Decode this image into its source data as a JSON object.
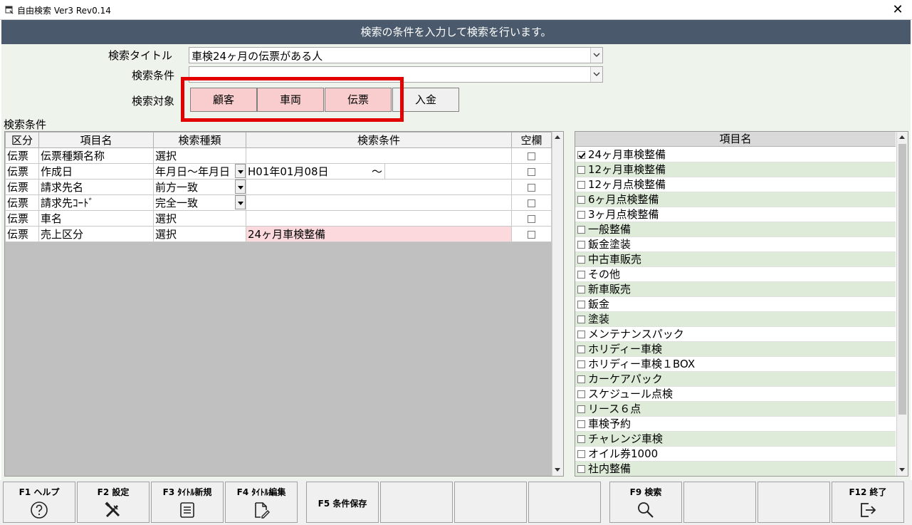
{
  "window": {
    "title": "自由検索 Ver3 Rev0.14",
    "close_symbol": "✕"
  },
  "banner": "検索の条件を入力して検索を行います。",
  "form": {
    "title_label": "検索タイトル",
    "title_value": "車検24ヶ月の伝票がある人",
    "condition_label": "検索条件",
    "condition_value": "",
    "target_label": "検索対象",
    "targets": [
      "顧客",
      "車両",
      "伝票",
      "入金"
    ],
    "selected_targets": [
      "顧客",
      "車両",
      "伝票"
    ]
  },
  "grid": {
    "section_label": "検索条件",
    "headers": [
      "区分",
      "項目名",
      "検索種類",
      "検索条件",
      "空欄"
    ],
    "rows": [
      {
        "kubun": "伝票",
        "item": "伝票種類名称",
        "type": "選択",
        "condition": "",
        "condition_to": "",
        "blank": false
      },
      {
        "kubun": "伝票",
        "item": "作成日",
        "type": "年月日～年月日",
        "condition": "H01年01月08日",
        "condition_to": "～",
        "blank": false
      },
      {
        "kubun": "伝票",
        "item": "請求先名",
        "type": "前方一致",
        "condition": "",
        "condition_to": "",
        "blank": false
      },
      {
        "kubun": "伝票",
        "item": "請求先ｺｰﾄﾞ",
        "type": "完全一致",
        "condition": "",
        "condition_to": "",
        "blank": false
      },
      {
        "kubun": "伝票",
        "item": "車名",
        "type": "選択",
        "condition": "",
        "condition_to": "",
        "blank": false
      },
      {
        "kubun": "伝票",
        "item": "売上区分",
        "type": "選択",
        "condition": "24ヶ月車検整備",
        "condition_to": "",
        "blank": false
      }
    ]
  },
  "list": {
    "header": "項目名",
    "items": [
      {
        "label": "24ヶ月車検整備",
        "checked": true
      },
      {
        "label": "12ヶ月車検整備",
        "checked": false
      },
      {
        "label": "12ヶ月点検整備",
        "checked": false
      },
      {
        "label": "6ヶ月点検整備",
        "checked": false
      },
      {
        "label": "3ヶ月点検整備",
        "checked": false
      },
      {
        "label": "一般整備",
        "checked": false
      },
      {
        "label": "鈑金塗装",
        "checked": false
      },
      {
        "label": "中古車販売",
        "checked": false
      },
      {
        "label": "その他",
        "checked": false
      },
      {
        "label": "新車販売",
        "checked": false
      },
      {
        "label": "鈑金",
        "checked": false
      },
      {
        "label": "塗装",
        "checked": false
      },
      {
        "label": "メンテナンスパック",
        "checked": false
      },
      {
        "label": "ホリディー車検",
        "checked": false
      },
      {
        "label": "ホリディー車検１BOX",
        "checked": false
      },
      {
        "label": "カーケアパック",
        "checked": false
      },
      {
        "label": "スケジュール点検",
        "checked": false
      },
      {
        "label": "リース６点",
        "checked": false
      },
      {
        "label": "車検予約",
        "checked": false
      },
      {
        "label": "チャレンジ車検",
        "checked": false
      },
      {
        "label": "オイル券1000",
        "checked": false
      },
      {
        "label": "社内整備",
        "checked": false
      }
    ]
  },
  "fkeys": {
    "f1": "F1 ヘルプ",
    "f2": "F2 設定",
    "f3": "F3 ﾀｲﾄﾙ新規",
    "f4": "F4 ﾀｲﾄﾙ編集",
    "f5": "F5 条件保存",
    "f9": "F9 検索",
    "f12": "F12 終了"
  },
  "icons": {
    "f1": "help-icon",
    "f2": "tools-icon",
    "f3": "document-list-icon",
    "f4": "edit-document-icon",
    "f9": "search-icon",
    "f12": "exit-icon"
  },
  "colors": {
    "banner": "#4a5a6c",
    "selected_target": "#f9cccd",
    "highlight": "#e30000",
    "list_alt_row": "#deebd8",
    "main_background": "#eef3ec"
  }
}
